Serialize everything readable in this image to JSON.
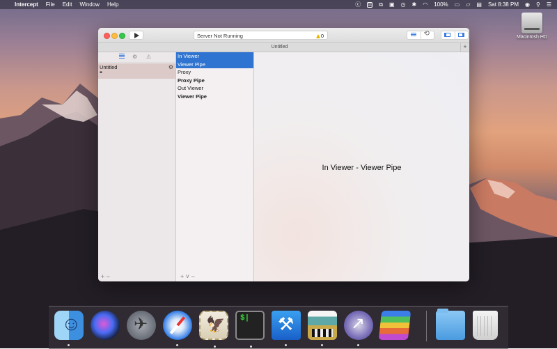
{
  "menubar": {
    "apple": "",
    "app_name": "Intercept",
    "menus": [
      "File",
      "Edit",
      "Window",
      "Help"
    ],
    "status_icons": [
      "creative-cloud-icon",
      "calendar-icon",
      "dropbox-icon",
      "screen-icon",
      "time-machine-icon",
      "bluetooth-icon",
      "wifi-icon"
    ],
    "calendar_day": "11",
    "battery": "100%",
    "clock": "Sat 8:38 PM"
  },
  "desktop": {
    "drive_label": "Macintosh HD"
  },
  "window": {
    "status_text": "Server Not Running",
    "warning_count": "0",
    "tab_title": "Untitled",
    "add_tab": "+",
    "sessions": [
      {
        "name": "Untitled",
        "sub": "••"
      }
    ],
    "left_footer": "+ −",
    "pipes": [
      {
        "label": "In Viewer",
        "selected": true,
        "bold": false
      },
      {
        "label": "Viewer Pipe",
        "selected": true,
        "bold": false
      },
      {
        "label": "Proxy",
        "selected": false,
        "bold": false
      },
      {
        "label": "Proxy Pipe",
        "selected": false,
        "bold": true
      },
      {
        "label": "Out Viewer",
        "selected": false,
        "bold": false
      },
      {
        "label": "Viewer Pipe",
        "selected": false,
        "bold": true
      }
    ],
    "middle_footer": "+ ˅ −",
    "detail_text": "In Viewer - Viewer Pipe"
  },
  "dock": {
    "items": [
      "finder",
      "siri",
      "launchpad",
      "safari",
      "mail",
      "terminal",
      "xcode",
      "charles",
      "intercept",
      "stacks",
      "folder",
      "trash"
    ]
  },
  "colors": {
    "selection": "#2f74d0",
    "session_highlight": "#dccac8"
  }
}
